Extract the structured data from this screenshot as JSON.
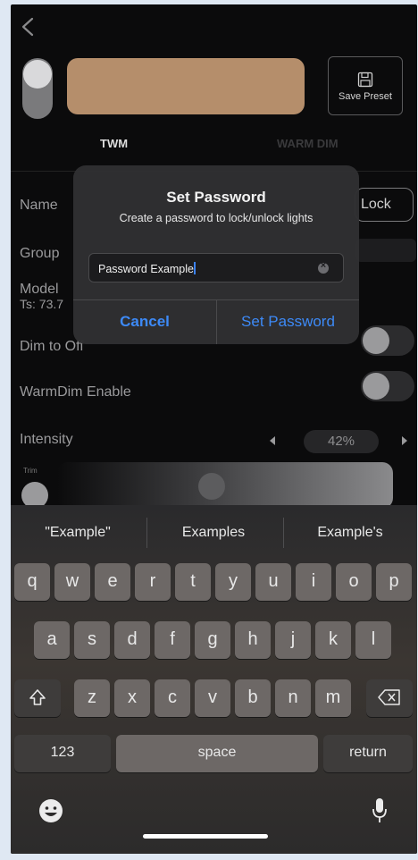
{
  "header": {
    "save_preset_label": "Save Preset",
    "swatch_color": "#b58e6b"
  },
  "tabs": [
    {
      "label": "TWM"
    },
    {
      "label": "WARM DIM"
    }
  ],
  "rows": {
    "name_label": "Name",
    "lock_button_label": "Lock",
    "group_label": "Group",
    "model_label": "Model",
    "ts_label": "Ts: 73.7",
    "dim_to_off_label": "Dim to Off",
    "warmdim_enable_label": "WarmDim Enable",
    "intensity_label": "Intensity",
    "intensity_value": "42%",
    "trim_label": "Trim"
  },
  "dialog": {
    "title": "Set Password",
    "message": "Create a password to lock/unlock lights",
    "input_value": "Password Example",
    "cancel_label": "Cancel",
    "confirm_label": "Set Password",
    "accent_color": "#3d8af7"
  },
  "keyboard": {
    "suggestions": [
      "\"Example\"",
      "Examples",
      "Example's"
    ],
    "row1": [
      "q",
      "w",
      "e",
      "r",
      "t",
      "y",
      "u",
      "i",
      "o",
      "p"
    ],
    "row2": [
      "a",
      "s",
      "d",
      "f",
      "g",
      "h",
      "j",
      "k",
      "l"
    ],
    "row3": [
      "z",
      "x",
      "c",
      "v",
      "b",
      "n",
      "m"
    ],
    "numbers_label": "123",
    "space_label": "space",
    "return_label": "return"
  }
}
